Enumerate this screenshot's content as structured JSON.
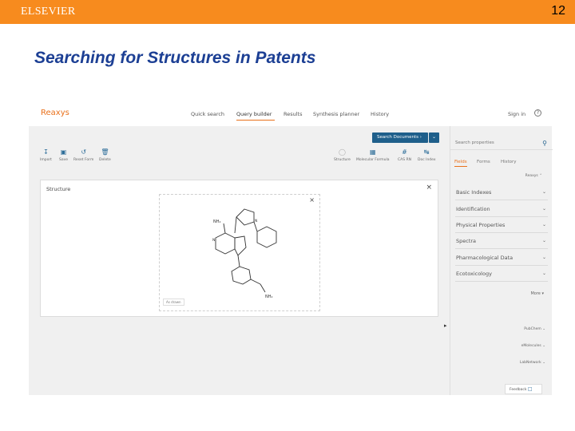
{
  "slide": {
    "logo": "ELSEVIER",
    "page_number": "12",
    "title": "Searching for Structures in Patents",
    "brand_color": "#f78b1e",
    "title_color": "#1c3f94"
  },
  "app": {
    "logo": "Reaxys",
    "nav": [
      "Quick search",
      "Query builder",
      "Results",
      "Synthesis planner",
      "History"
    ],
    "active_nav": "Query builder",
    "sign_in": "Sign in",
    "accent_color": "#e9711c",
    "primary_color": "#1f5f8b"
  },
  "toolbar": {
    "search_button": "Search Documents",
    "search_button_icon": "chevron-right-icon",
    "dropdown_icon": "chevron-down-icon",
    "tools": [
      {
        "label": "Import",
        "icon": "import-icon"
      },
      {
        "label": "Save",
        "icon": "save-icon"
      },
      {
        "label": "Reset Form",
        "icon": "reset-icon"
      },
      {
        "label": "Delete",
        "icon": "trash-icon"
      }
    ],
    "right_tools": [
      {
        "label": "Structure",
        "icon": "structure-icon"
      },
      {
        "label": "Molecular Formula",
        "icon": "formula-icon"
      },
      {
        "label": "CAS RN",
        "icon": "hash-icon"
      },
      {
        "label": "Doc Index",
        "icon": "doc-index-icon"
      }
    ]
  },
  "structure": {
    "label": "Structure",
    "drawn_tag": "As drawn",
    "atoms": {
      "nh2_top": "NH₂",
      "nh2_bottom": "NH₂",
      "n": "N"
    }
  },
  "sidebar": {
    "search_placeholder": "Search properties",
    "tabs": [
      "Fields",
      "Forms",
      "History"
    ],
    "active_tab": "Fields",
    "group_label": "Reaxys",
    "items": [
      "Basic Indexes",
      "Identification",
      "Physical Properties",
      "Spectra",
      "Pharmacological Data",
      "Ecotoxicology"
    ],
    "more": "More",
    "links": [
      "PubChem",
      "eMolecules",
      "LabNetwork"
    ],
    "feedback": "Feedback"
  }
}
